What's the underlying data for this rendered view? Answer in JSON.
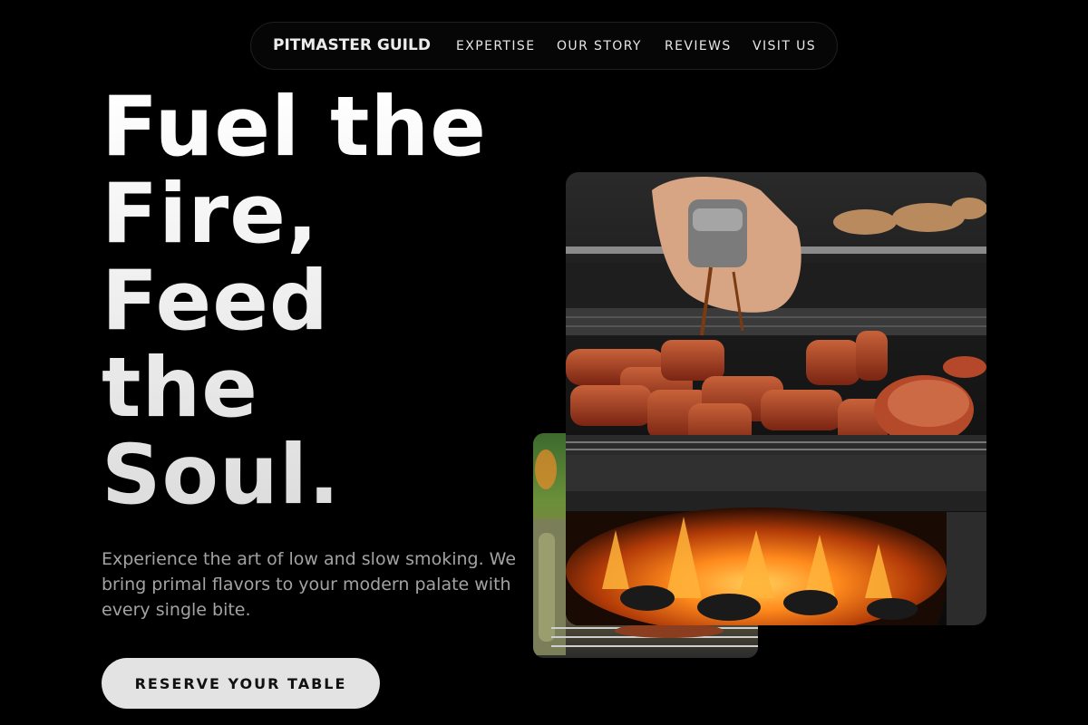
{
  "nav": {
    "brand": "PITMASTER GUILD",
    "links": [
      "EXPERTISE",
      "OUR STORY",
      "REVIEWS",
      "VISIT US"
    ]
  },
  "hero": {
    "headline_lines": [
      "Fuel the",
      "Fire,",
      "Feed",
      "the",
      "Soul."
    ],
    "subtitle": "Experience the art of low and slow smoking. We bring primal flavors to your modern palate with every single bite.",
    "cta_label": "RESERVE YOUR TABLE"
  },
  "images": {
    "main": "grill-meat-photo",
    "secondary": "grill-closeup-photo"
  },
  "colors": {
    "background": "#000000",
    "text": "#ffffff",
    "muted": "#a3a3a3",
    "button": "#e3e3e3"
  }
}
